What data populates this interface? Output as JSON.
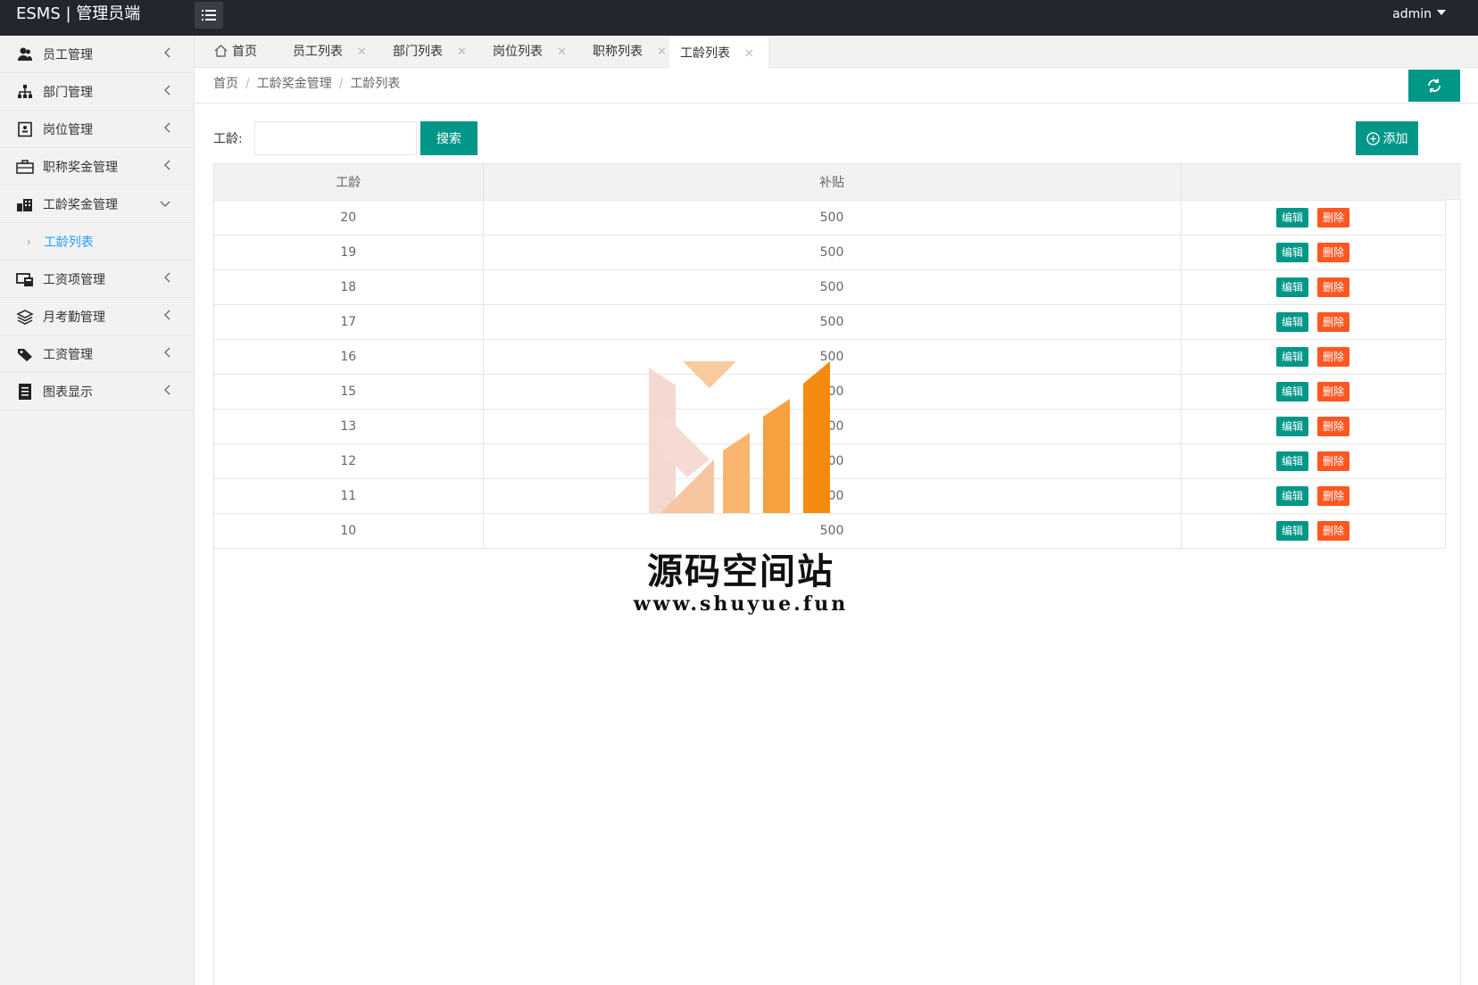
{
  "app": {
    "title": "ESMS | 管理员端",
    "user": "admin"
  },
  "sidebar": {
    "items": [
      {
        "label": "员工管理",
        "icon": "users-icon"
      },
      {
        "label": "部门管理",
        "icon": "sitemap-icon"
      },
      {
        "label": "岗位管理",
        "icon": "id-card-icon"
      },
      {
        "label": "职称奖金管理",
        "icon": "briefcase-icon"
      },
      {
        "label": "工龄奖金管理",
        "icon": "building-icon",
        "expanded": true
      },
      {
        "label": "工资项管理",
        "icon": "monitor-icon"
      },
      {
        "label": "月考勤管理",
        "icon": "layers-icon"
      },
      {
        "label": "工资管理",
        "icon": "tag-icon"
      },
      {
        "label": "图表显示",
        "icon": "document-icon"
      }
    ],
    "sub_item": {
      "label": "工龄列表",
      "active": true
    }
  },
  "tabs": [
    {
      "label": "首页",
      "closable": false
    },
    {
      "label": "员工列表",
      "closable": true
    },
    {
      "label": "部门列表",
      "closable": true
    },
    {
      "label": "岗位列表",
      "closable": true
    },
    {
      "label": "职称列表",
      "closable": true
    },
    {
      "label": "工龄列表",
      "closable": true,
      "active": true
    }
  ],
  "breadcrumb": [
    "首页",
    "工龄奖金管理",
    "工龄列表"
  ],
  "search": {
    "label": "工龄:",
    "value": "",
    "placeholder": "",
    "button": "搜索"
  },
  "add_button": "添加",
  "table": {
    "columns": [
      "工龄",
      "补贴",
      ""
    ],
    "rows": [
      [
        "20",
        "500"
      ],
      [
        "19",
        "500"
      ],
      [
        "18",
        "500"
      ],
      [
        "17",
        "500"
      ],
      [
        "16",
        "500"
      ],
      [
        "15",
        "500"
      ],
      [
        "13",
        "500"
      ],
      [
        "12",
        "500"
      ],
      [
        "11",
        "500"
      ],
      [
        "10",
        "500"
      ]
    ],
    "edit_label": "编辑",
    "delete_label": "删除"
  },
  "watermark": {
    "text": "源码空间站",
    "url": "www.shuyue.fun"
  },
  "colors": {
    "primary": "#009688",
    "danger": "#ff5722",
    "topbar": "#23262e",
    "link": "#1e9fff"
  }
}
